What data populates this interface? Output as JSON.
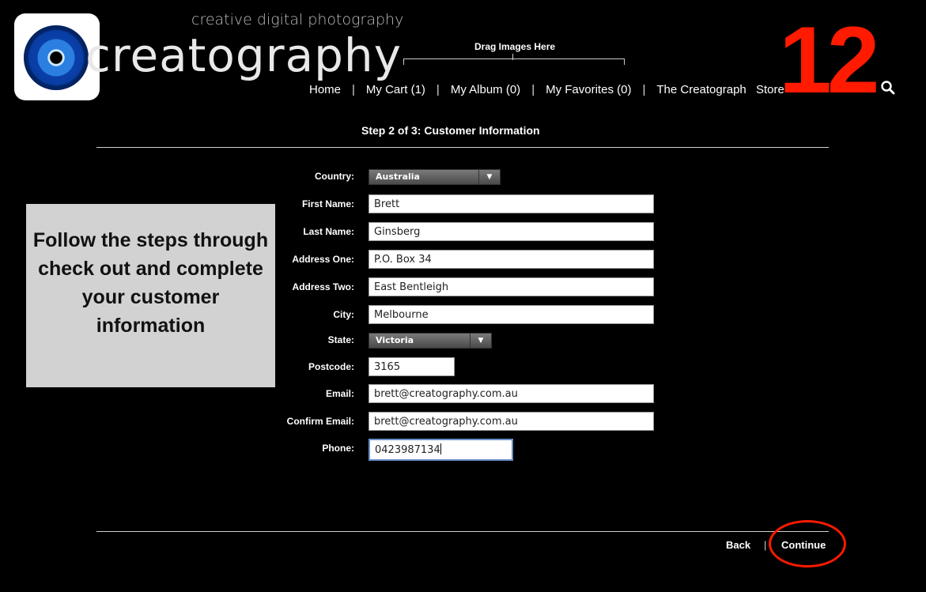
{
  "brand": {
    "tagline": "creative digital photography",
    "wordmark": "creatography"
  },
  "drag_zone": {
    "label": "Drag Images Here"
  },
  "nav": {
    "items": [
      "Home",
      "My Cart (1)",
      "My Album (0)",
      "My Favorites (0)",
      "The Creatograph",
      "Store"
    ],
    "separator": "|"
  },
  "overlay": {
    "step_number": "12",
    "instruction": "Follow the steps through check out and complete your customer information"
  },
  "page": {
    "title": "Step 2 of 3: Customer Information"
  },
  "form": {
    "country": {
      "label": "Country:",
      "value": "Australia"
    },
    "first_name": {
      "label": "First Name:",
      "value": "Brett"
    },
    "last_name": {
      "label": "Last Name:",
      "value": "Ginsberg"
    },
    "address_one": {
      "label": "Address One:",
      "value": "P.O. Box 34"
    },
    "address_two": {
      "label": "Address Two:",
      "value": "East Bentleigh"
    },
    "city": {
      "label": "City:",
      "value": "Melbourne"
    },
    "state": {
      "label": "State:",
      "value": "Victoria"
    },
    "postcode": {
      "label": "Postcode:",
      "value": "3165"
    },
    "email": {
      "label": "Email:",
      "value": "brett@creatography.com.au"
    },
    "confirm_email": {
      "label": "Confirm Email:",
      "value": "brett@creatography.com.au"
    },
    "phone": {
      "label": "Phone:",
      "value": "0423987134"
    }
  },
  "footer": {
    "back": "Back",
    "separator": "|",
    "continue": "Continue"
  },
  "colors": {
    "background": "#000000",
    "accent_red": "#ff1a00",
    "info_box": "#d2d2d2"
  },
  "icons": {
    "search": "search-icon",
    "dropdown": "triangle-down-icon",
    "logo": "eye-icon"
  }
}
